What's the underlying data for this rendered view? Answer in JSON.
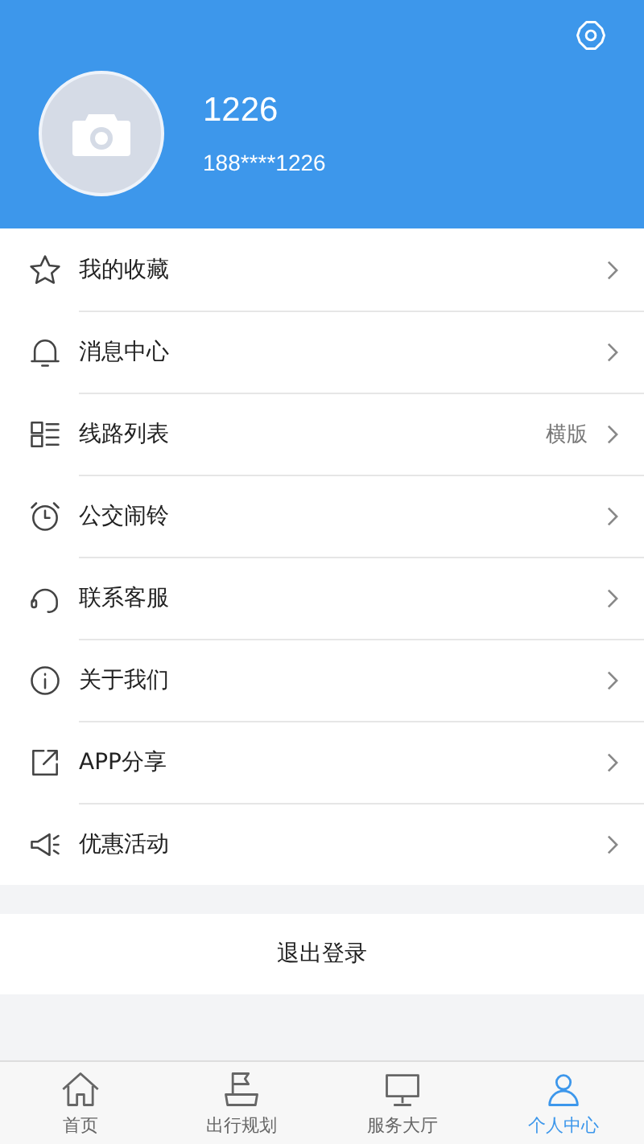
{
  "profile": {
    "name": "1226",
    "phone": "188****1226"
  },
  "menu": [
    {
      "kind": "star",
      "label": "我的收藏"
    },
    {
      "kind": "bell",
      "label": "消息中心"
    },
    {
      "kind": "list",
      "label": "线路列表",
      "value": "横版"
    },
    {
      "kind": "alarm",
      "label": "公交闹铃"
    },
    {
      "kind": "headset",
      "label": "联系客服"
    },
    {
      "kind": "info",
      "label": "关于我们"
    },
    {
      "kind": "share",
      "label": "APP分享"
    },
    {
      "kind": "megaphone",
      "label": "优惠活动"
    }
  ],
  "logout": "退出登录",
  "tabs": [
    {
      "kind": "home",
      "label": "首页",
      "selected": false
    },
    {
      "kind": "flag",
      "label": "出行规划",
      "selected": false
    },
    {
      "kind": "hall",
      "label": "服务大厅",
      "selected": false
    },
    {
      "kind": "person",
      "label": "个人中心",
      "selected": true
    }
  ]
}
